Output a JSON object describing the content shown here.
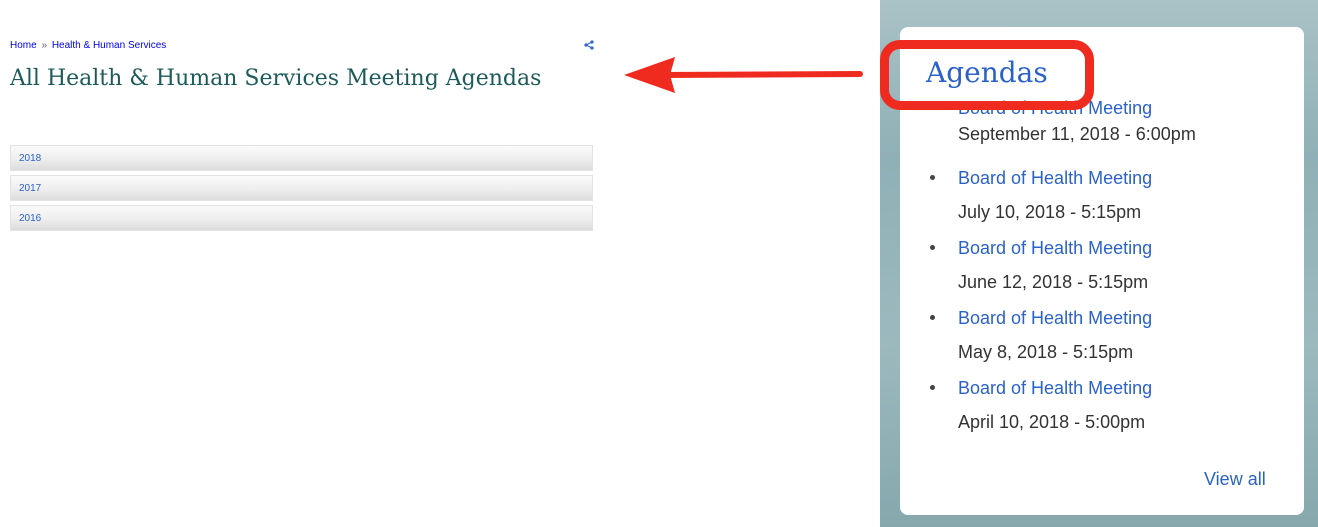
{
  "breadcrumb": {
    "home": "Home",
    "separator": "»",
    "current": "Health & Human Services"
  },
  "share_icon": "share-icon",
  "page_title": "All Health & Human Services Meeting Agendas",
  "years": [
    "2018",
    "2017",
    "2016"
  ],
  "arrow_color": "#ef2b1f",
  "widget": {
    "title": "Agendas",
    "highlight_color": "#ef2b1f",
    "items": [
      {
        "title": "Board of Health Meeting",
        "date": "September 11, 2018 - 6:00pm"
      },
      {
        "title": "Board of Health Meeting",
        "date": "July 10, 2018 - 5:15pm"
      },
      {
        "title": "Board of Health Meeting",
        "date": "June 12, 2018 - 5:15pm"
      },
      {
        "title": "Board of Health Meeting",
        "date": "May 8, 2018 - 5:15pm"
      },
      {
        "title": "Board of Health Meeting",
        "date": "April 10, 2018 - 5:00pm"
      }
    ],
    "view_all": "View all"
  }
}
